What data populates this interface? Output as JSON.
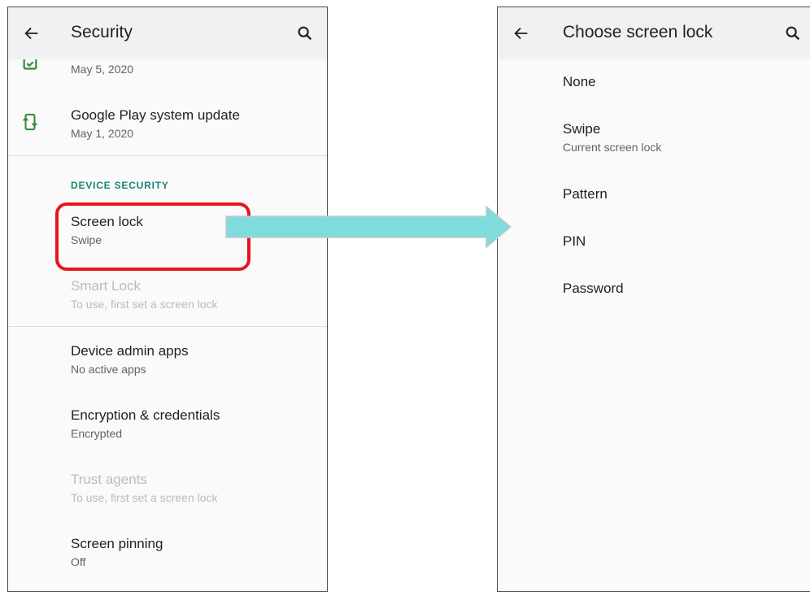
{
  "left_screen": {
    "title": "Security",
    "partial_item": {
      "subtitle": "May 5, 2020"
    },
    "google_play_update": {
      "title": "Google Play system update",
      "subtitle": "May 1, 2020"
    },
    "section_header": "DEVICE SECURITY",
    "items": [
      {
        "title": "Screen lock",
        "subtitle": "Swipe",
        "enabled": true
      },
      {
        "title": "Smart Lock",
        "subtitle": "To use, first set a screen lock",
        "enabled": false
      },
      {
        "title": "Device admin apps",
        "subtitle": "No active apps",
        "enabled": true
      },
      {
        "title": "Encryption & credentials",
        "subtitle": "Encrypted",
        "enabled": true
      },
      {
        "title": "Trust agents",
        "subtitle": "To use, first set a screen lock",
        "enabled": false
      },
      {
        "title": "Screen pinning",
        "subtitle": "Off",
        "enabled": true
      }
    ]
  },
  "right_screen": {
    "title": "Choose screen lock",
    "options": [
      {
        "title": "None"
      },
      {
        "title": "Swipe",
        "subtitle": "Current screen lock"
      },
      {
        "title": "Pattern"
      },
      {
        "title": "PIN"
      },
      {
        "title": "Password"
      }
    ]
  },
  "colors": {
    "accent_teal": "#1a8574",
    "icon_green": "#2e8b3a",
    "highlight_red": "#e8141c",
    "arrow_cyan": "#7fdcdc",
    "disabled_text": "#b9bbbe"
  }
}
